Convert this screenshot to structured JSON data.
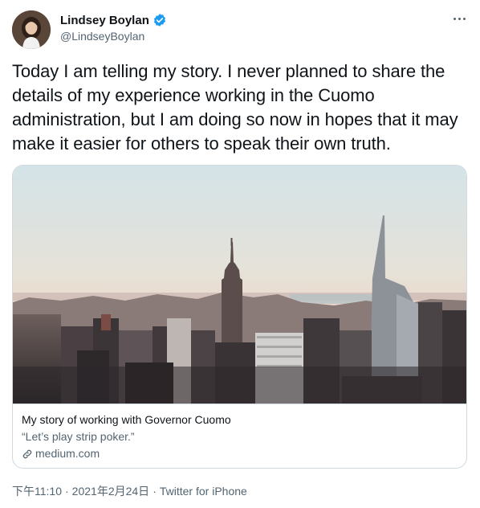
{
  "author": {
    "display_name": "Lindsey Boylan",
    "handle": "@LindseyBoylan",
    "verified": true
  },
  "tweet": {
    "text": "Today I am telling my story. I never planned to share the details of my experience working in the Cuomo administration, but I am doing so now in hopes that it may make it easier for others to speak their own truth."
  },
  "card": {
    "title": "My story of working with Governor Cuomo",
    "description": "“Let’s play strip poker.”",
    "domain": "medium.com",
    "image_subject": "city skyline"
  },
  "meta": {
    "time": "下午11:10",
    "separator": "·",
    "date": "2021年2月24日",
    "separator2": "·",
    "source": "Twitter for iPhone"
  },
  "icons": {
    "verified": "verified-badge-icon",
    "more": "more-dots-icon",
    "link": "link-icon"
  },
  "colors": {
    "text_primary": "#0f1419",
    "text_secondary": "#536471",
    "verified_blue": "#1d9bf0",
    "border": "#cfd9de"
  }
}
